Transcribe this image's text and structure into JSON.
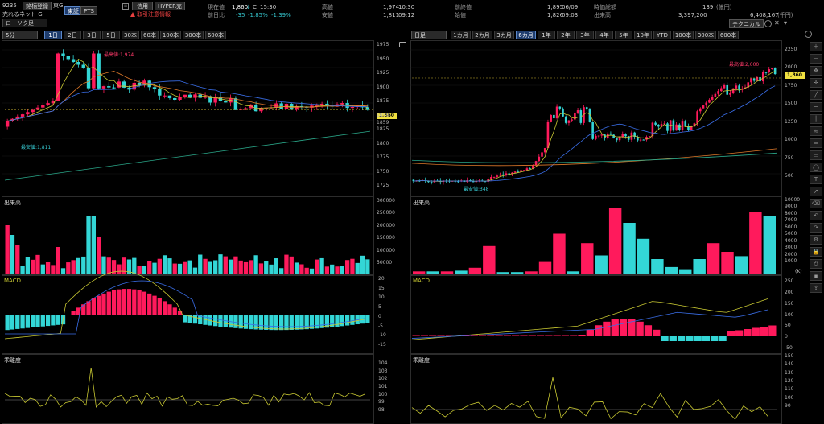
{
  "header": {
    "code": "9235",
    "watch_btn": "銘柄登録",
    "market": "東G",
    "name": "売れるネット G",
    "exchange_tse": "東証",
    "exchange_pts": "PTS",
    "credit_btn": "信用",
    "hyper_btn": "HYPER売",
    "caution": "取引注意情報",
    "chart_type": "ローソク足",
    "price_label": "現在値",
    "price": "1,860",
    "price_arrow": "↓",
    "price_flag": "C",
    "price_time": "15:30",
    "prev_label": "前日比",
    "prev_change": "-35",
    "prev_pct": "-1.85%",
    "prev_pct2": "-1.39%",
    "high_label": "高値",
    "high_val": "1,974",
    "high_time": "10:30",
    "low_label": "安値",
    "low_val": "1,811",
    "low_time": "09:12",
    "prevclose_label": "前終値",
    "prevclose_val": "1,895",
    "prevclose_date": "06/09",
    "open_label": "始値",
    "open_val": "1,826",
    "open_time": "09:03",
    "mcap_label": "時価総額",
    "mcap_val": "139",
    "mcap_unit": "(億円)",
    "vol_label": "出来高",
    "vol_val": "3,397,200",
    "turnover_val": "6,408,167",
    "turnover_unit": "(千円)",
    "tech_btn": "テクニカル"
  },
  "left": {
    "interval_select": "5分",
    "tabs": [
      "1日",
      "2日",
      "3日",
      "5日",
      "30本",
      "60本",
      "100本",
      "300本",
      "600本"
    ],
    "active_tab": "1日",
    "yaxis": [
      "1975",
      "1950",
      "1925",
      "1900",
      "1875",
      "1850",
      "1825",
      "1800",
      "1775",
      "1750",
      "1725"
    ],
    "price_tag": "1,860",
    "price_tag2": "1859",
    "high_note": "最高値:1,974",
    "low_note": "最安値:1,811",
    "vol_title": "出来高",
    "vol_axis": [
      "300000",
      "250000",
      "200000",
      "150000",
      "100000",
      "50000"
    ],
    "macd_title": "MACD",
    "macd_axis": [
      "20",
      "15",
      "10",
      "5",
      "0",
      "-5",
      "-10",
      "-15"
    ],
    "dev_title": "乖離度",
    "dev_axis": [
      "104",
      "103",
      "102",
      "101",
      "100",
      "99",
      "98"
    ]
  },
  "right": {
    "interval_select": "日足",
    "tabs": [
      "1カ月",
      "2カ月",
      "3カ月",
      "6カ月",
      "1年",
      "2年",
      "3年",
      "4年",
      "5年",
      "10年",
      "YTD",
      "100本",
      "300本",
      "600本"
    ],
    "active_tab": "6カ月",
    "yaxis": [
      "2250",
      "2000",
      "1750",
      "1500",
      "1250",
      "1000",
      "750",
      "500"
    ],
    "price_tag": "1,860",
    "high_note": "最高値:2,000",
    "low_note": "最安値:348",
    "vol_title": "出来高",
    "vol_axis": [
      "10000",
      "9000",
      "8000",
      "7000",
      "6000",
      "5000",
      "4000",
      "3000",
      "2000",
      "1000"
    ],
    "vol_unit": "(K)",
    "macd_title": "MACD",
    "macd_axis": [
      "250",
      "200",
      "150",
      "100",
      "50",
      "0",
      "-50"
    ],
    "dev_title": "乖離度",
    "dev_axis": [
      "150",
      "140",
      "130",
      "120",
      "110",
      "100",
      "90"
    ]
  },
  "colors": {
    "up": "#ff1a5c",
    "down": "#33d6d6",
    "ma_short": "#c8c832",
    "ma_mid": "#3a6ee8",
    "ma_long": "#2aa88a",
    "ma_orange": "#e07a2a"
  }
}
